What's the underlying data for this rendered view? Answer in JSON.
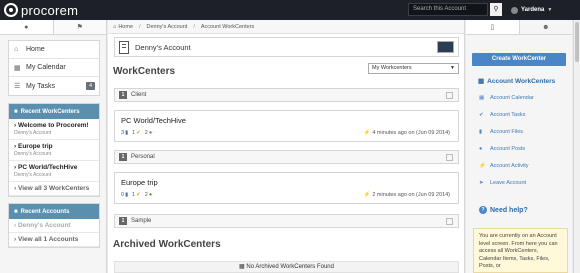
{
  "topbar": {
    "logo_text": "procorem",
    "search_placeholder": "Search this Account",
    "search_icon": "search-icon",
    "user_name": "Yardena"
  },
  "left_sidebar": {
    "tabs": [
      {
        "icon": "globe-icon"
      },
      {
        "icon": "bookmark-icon"
      }
    ],
    "nav": [
      {
        "label": "Home",
        "icon": "home-icon"
      },
      {
        "label": "My Calendar",
        "icon": "calendar-icon"
      },
      {
        "label": "My Tasks",
        "icon": "tasks-icon",
        "badge": "4"
      }
    ],
    "recent_workcenters": {
      "title": "Recent WorkCenters",
      "items": [
        {
          "title": "Welcome to Procorem!",
          "sub": "Denny's Account"
        },
        {
          "title": "Europe trip",
          "sub": "Denny's Account"
        },
        {
          "title": "PC World/TechHive",
          "sub": "Denny's Account"
        }
      ],
      "view_all": "View all 3 WorkCenters"
    },
    "recent_accounts": {
      "title": "Recent Accounts",
      "items": [
        {
          "title": "Denny's Account"
        }
      ],
      "view_all": "View all 1 Accounts"
    }
  },
  "main": {
    "breadcrumb": [
      "Home",
      "Denny's Account",
      "Account WorkCenters"
    ],
    "account_name": "Denny's Account",
    "section_title": "WorkCenters",
    "filter_selected": "My Workcenters",
    "groups": [
      {
        "num": "1",
        "name": "Client"
      },
      {
        "num": "1",
        "name": "Personal"
      },
      {
        "num": "1",
        "name": "Sample"
      }
    ],
    "cards": [
      {
        "title": "PC World/TechHive",
        "files": "3",
        "tasks": "1",
        "posts": "2",
        "time": "4 minutes ago on (Jun 09 2014)"
      },
      {
        "title": "Europe trip",
        "files": "0",
        "tasks": "1",
        "posts": "2",
        "time": "2 minutes ago on (Jun 09 2014)"
      }
    ],
    "archived_title": "Archived WorkCenters",
    "archived_empty": "No Archived WorkCenters Found"
  },
  "right_sidebar": {
    "tabs": [
      {
        "icon": "document-icon"
      },
      {
        "icon": "user-icon"
      }
    ],
    "create_button": "Create WorkCenter",
    "section_title": "Account WorkCenters",
    "links": [
      {
        "label": "Account Calendar",
        "icon": "calendar-icon"
      },
      {
        "label": "Account Tasks",
        "icon": "check-icon"
      },
      {
        "label": "Account Files",
        "icon": "folder-icon"
      },
      {
        "label": "Account Posts",
        "icon": "comment-icon"
      },
      {
        "label": "Account Activity",
        "icon": "activity-icon"
      },
      {
        "label": "Leave Account",
        "icon": "leave-icon"
      }
    ],
    "help_title": "Need help?",
    "help_text": "You are currently on an Account level screen. From here you can access all WorkCenters, Calendar Items, Tasks, Files, Posts, or"
  }
}
